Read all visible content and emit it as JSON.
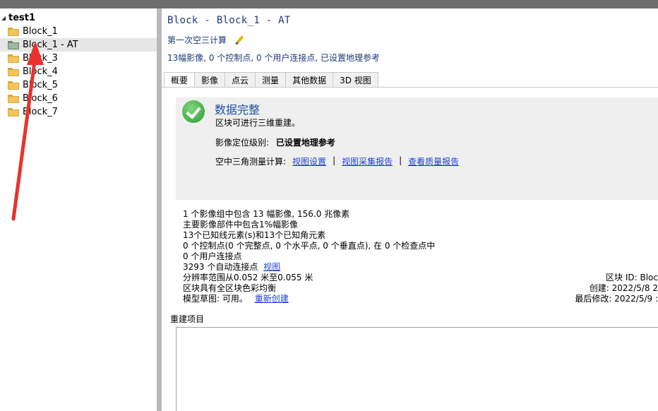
{
  "tree": {
    "root_label": "test1",
    "items": [
      {
        "label": "Block_1",
        "selected": false,
        "icon": "folder-icon"
      },
      {
        "label": "Block_1 - AT",
        "selected": true,
        "icon": "block-icon"
      },
      {
        "label": "Block_3",
        "selected": false,
        "icon": "folder-icon"
      },
      {
        "label": "Block_4",
        "selected": false,
        "icon": "folder-icon"
      },
      {
        "label": "Block_5",
        "selected": false,
        "icon": "folder-icon"
      },
      {
        "label": "Block_6",
        "selected": false,
        "icon": "folder-icon"
      },
      {
        "label": "Block_7",
        "selected": false,
        "icon": "folder-icon"
      }
    ]
  },
  "header": {
    "title": "Block - Block_1 - AT",
    "subtitle": "第一次空三计算",
    "summary": "13幅影像, 0 个控制点, 0 个用户连接点, 已设置地理参考"
  },
  "tabs": [
    "概要",
    "影像",
    "点云",
    "测量",
    "其他数据",
    "3D 视图"
  ],
  "active_tab": "概要",
  "status": {
    "title": "数据完整",
    "subtitle": "区块可进行三维重建。",
    "geo_label": "影像定位级别:",
    "geo_value": "已设置地理参考",
    "aerial_label": "空中三角测量计算:",
    "link_view_settings": "视图设置",
    "link_view_report": "视图采集报告",
    "link_quality_report": "查看质量报告",
    "separator": "|"
  },
  "info": {
    "line1": "1 个影像组中包含 13 幅影像, 156.0 兆像素",
    "line2": "主要影像部件中包含1%幅影像",
    "line3": "13个已知线元素(s)和13个已知角元素",
    "line4": "0 个控制点(0 个完整点, 0 个水平点, 0 个垂直点), 在 0 个检查点中",
    "line5": "0 个用户连接点",
    "line6_text": "3293 个自动连接点",
    "line6_link": "视图",
    "line7": "分辨率范围从0.052 米至0.055 米",
    "line8": "区块具有全区块色彩均衡",
    "line9_text": "模型草图: 可用。",
    "line9_link": "重新创建",
    "block_id": "区块 ID: Bloc",
    "created": "创建: 2022/5/8 2",
    "modified": "最后修改: 2022/5/9 :"
  },
  "rebuild": {
    "label": "重建项目"
  },
  "colors": {
    "title": "#1f3a7a",
    "link": "#1d3fd0",
    "status_title": "#1f4fa5",
    "annotation_arrow": "#e8322b"
  }
}
